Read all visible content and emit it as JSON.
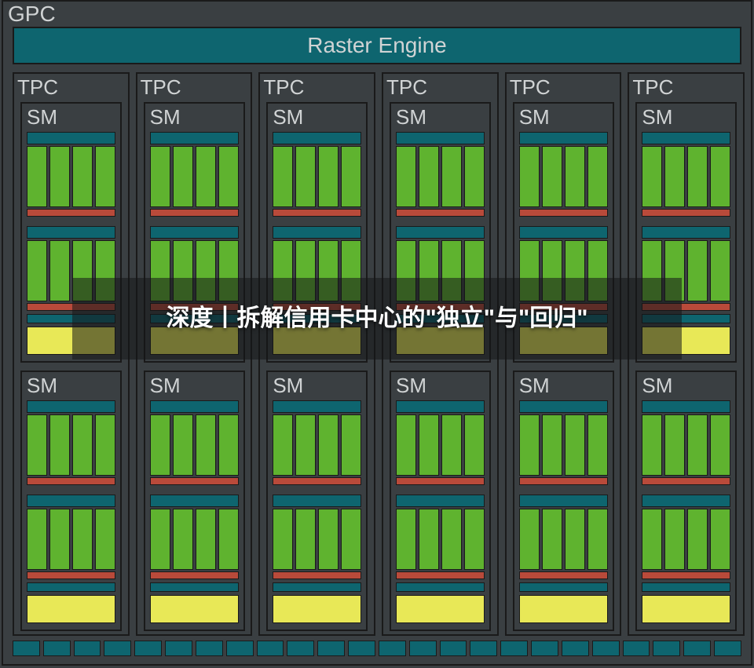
{
  "gpc_label": "GPC",
  "raster_label": "Raster Engine",
  "tpc_label": "TPC",
  "sm_label": "SM",
  "tpc_count": 6,
  "sm_per_tpc": 2,
  "footer_cell_count": 24,
  "overlay_text": "深度丨拆解信用卡中心的\"独立\"与\"回归\"",
  "colors": {
    "bg": "#3a3f42",
    "teal": "#0e656f",
    "green": "#5fb32f",
    "red": "#b94a3a",
    "yellow": "#e8e857",
    "border": "#1a1a1a",
    "text": "#d0d3d4"
  }
}
